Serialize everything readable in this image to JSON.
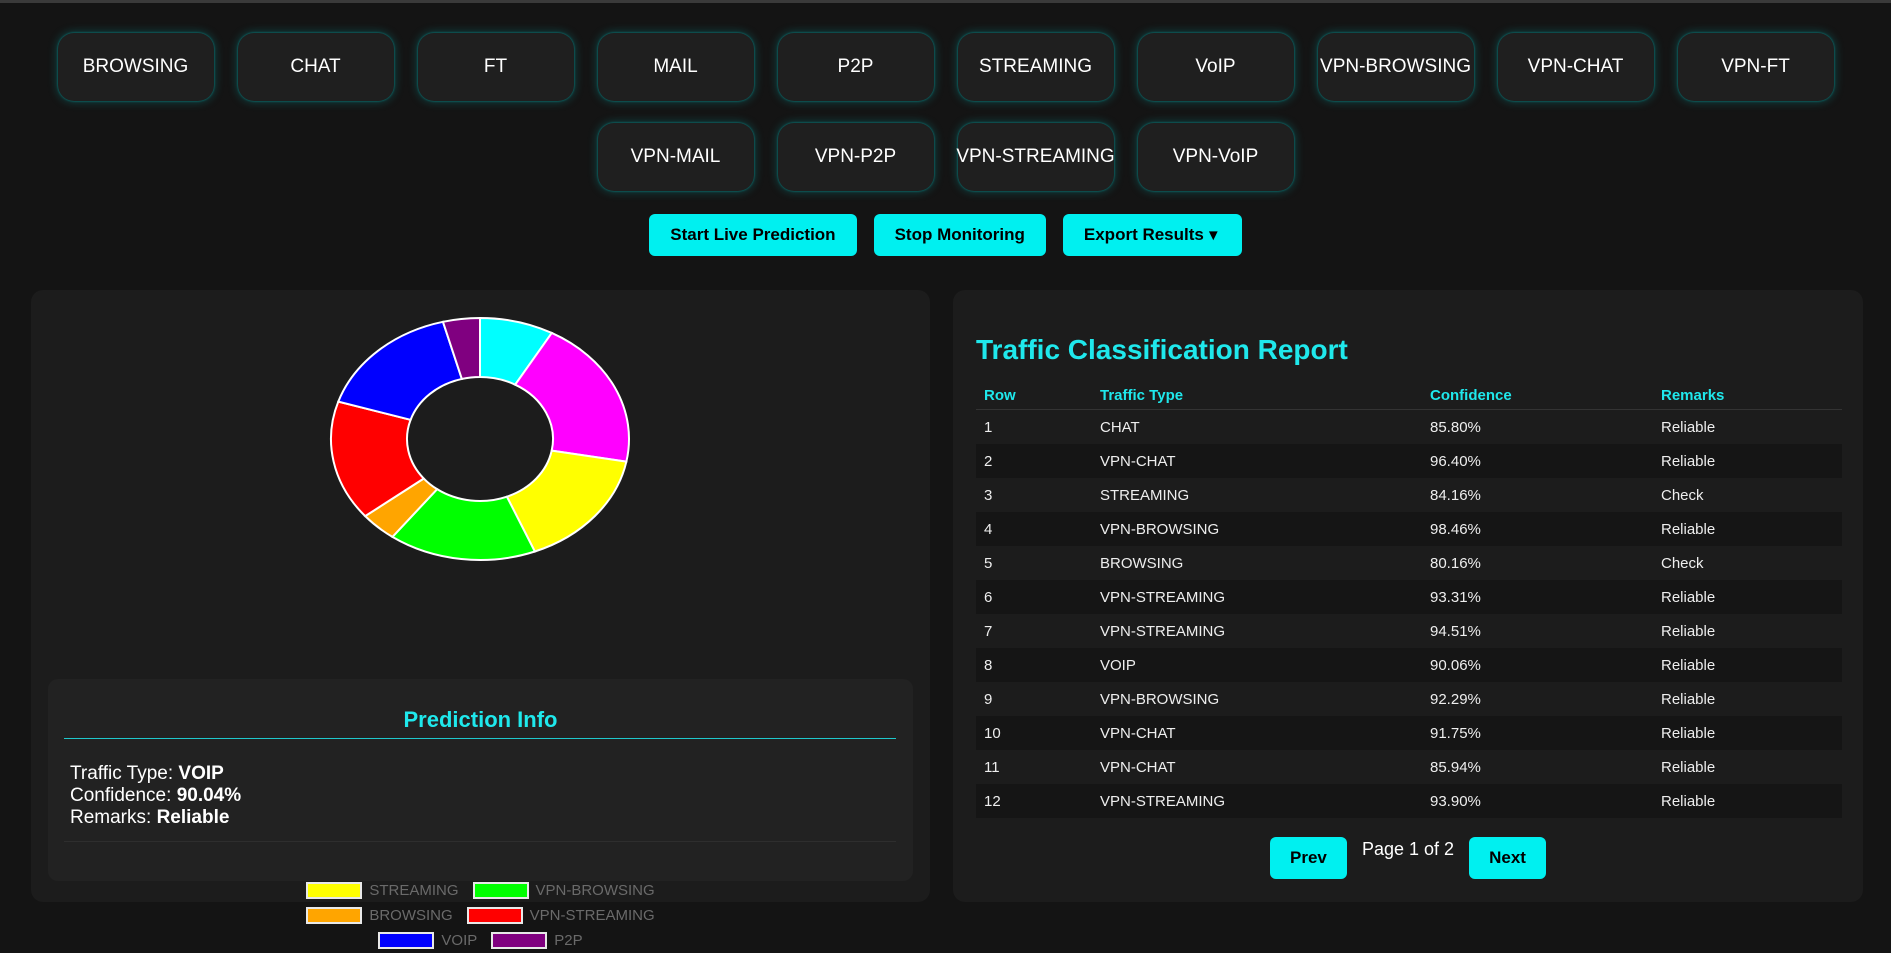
{
  "categories_row1": [
    "BROWSING",
    "CHAT",
    "FT",
    "MAIL",
    "P2P",
    "STREAMING",
    "VoIP",
    "VPN-BROWSING",
    "VPN-CHAT",
    "VPN-FT"
  ],
  "categories_row2": [
    "VPN-MAIL",
    "VPN-P2P",
    "VPN-STREAMING",
    "VPN-VoIP"
  ],
  "actions": {
    "start_label": "Start Live Prediction",
    "stop_label": "Stop Monitoring",
    "export_label": "Export Results",
    "export_arrow": "▼"
  },
  "chart_data": {
    "type": "pie",
    "donut": true,
    "slices": [
      {
        "label": "CHAT",
        "value": 2,
        "color": "#00ffff"
      },
      {
        "label": "VPN-CHAT",
        "value": 5,
        "color": "#ff00ff"
      },
      {
        "label": "STREAMING",
        "value": 4,
        "color": "#ffff00"
      },
      {
        "label": "VPN-BROWSING",
        "value": 4,
        "color": "#00ff00"
      },
      {
        "label": "BROWSING",
        "value": 1,
        "color": "#ffa500"
      },
      {
        "label": "VPN-STREAMING",
        "value": 4,
        "color": "#ff0000"
      },
      {
        "label": "VOIP",
        "value": 4,
        "color": "#0000ff"
      },
      {
        "label": "P2P",
        "value": 1,
        "color": "#800080"
      }
    ],
    "legend_rows": [
      [
        "CHAT",
        "VPN-CHAT"
      ],
      [
        "STREAMING",
        "VPN-BROWSING"
      ],
      [
        "BROWSING",
        "VPN-STREAMING"
      ],
      [
        "VOIP",
        "P2P"
      ]
    ]
  },
  "prediction": {
    "title": "Prediction Info",
    "type_label": "Traffic Type:",
    "type_value": "VOIP",
    "confidence_label": "Confidence:",
    "confidence_value": "90.04%",
    "remarks_label": "Remarks:",
    "remarks_value": "Reliable"
  },
  "report": {
    "title": "Traffic Classification Report",
    "columns": [
      "Row",
      "Traffic Type",
      "Confidence",
      "Remarks"
    ],
    "rows": [
      [
        "1",
        "CHAT",
        "85.80%",
        "Reliable"
      ],
      [
        "2",
        "VPN-CHAT",
        "96.40%",
        "Reliable"
      ],
      [
        "3",
        "STREAMING",
        "84.16%",
        "Check"
      ],
      [
        "4",
        "VPN-BROWSING",
        "98.46%",
        "Reliable"
      ],
      [
        "5",
        "BROWSING",
        "80.16%",
        "Check"
      ],
      [
        "6",
        "VPN-STREAMING",
        "93.31%",
        "Reliable"
      ],
      [
        "7",
        "VPN-STREAMING",
        "94.51%",
        "Reliable"
      ],
      [
        "8",
        "VOIP",
        "90.06%",
        "Reliable"
      ],
      [
        "9",
        "VPN-BROWSING",
        "92.29%",
        "Reliable"
      ],
      [
        "10",
        "VPN-CHAT",
        "91.75%",
        "Reliable"
      ],
      [
        "11",
        "VPN-CHAT",
        "85.94%",
        "Reliable"
      ],
      [
        "12",
        "VPN-STREAMING",
        "93.90%",
        "Reliable"
      ]
    ]
  },
  "pager": {
    "prev_label": "Prev",
    "page_text": "Page 1 of 2",
    "next_label": "Next"
  }
}
